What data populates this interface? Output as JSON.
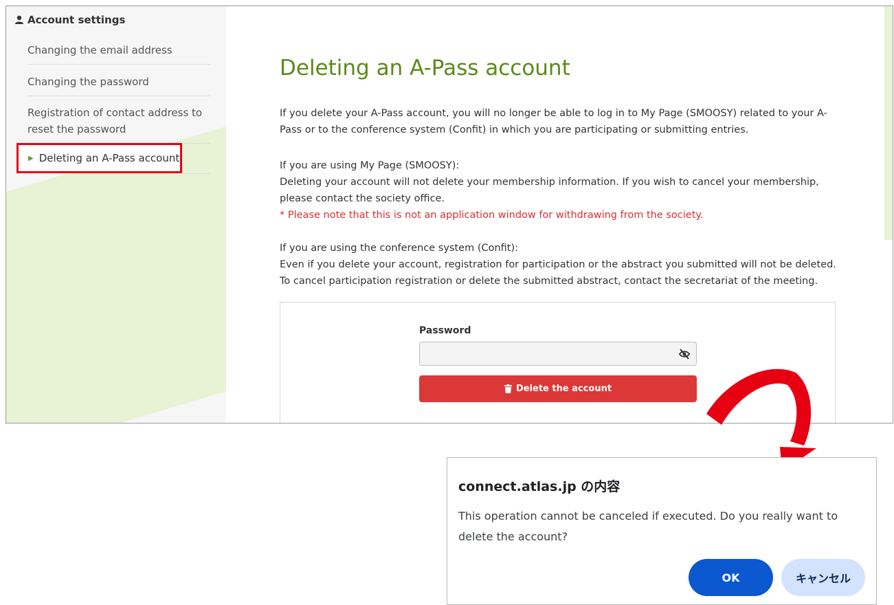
{
  "sidebar": {
    "heading": "Account settings",
    "items": [
      {
        "label": "Changing the email address"
      },
      {
        "label": "Changing the password"
      },
      {
        "label": "Registration of contact address to reset the password"
      },
      {
        "label": "Deleting an A-Pass account"
      }
    ]
  },
  "main": {
    "title": "Deleting an A-Pass account",
    "intro": "If you delete your A-Pass account, you will no longer be able to log in to My Page (SMOOSY) related to your A-Pass or to the conference system (Confit) in which you are participating or submitting entries.",
    "smoosy_heading": "If you are using My Page (SMOOSY):",
    "smoosy_text": "Deleting your account will not delete your membership information. If you wish to cancel your membership, please contact the society office.",
    "smoosy_warning": "* Please note that this is not an application window for withdrawing from the society.",
    "confit_heading": "If you are using the conference system (Confit):",
    "confit_text1": "Even if you delete your account, registration for participation or the abstract you submitted will not be deleted.",
    "confit_text2": "To cancel participation registration or delete the submitted abstract, contact the secretariat of the meeting.",
    "form": {
      "password_label": "Password",
      "password_value": "",
      "delete_label": "Delete the account"
    }
  },
  "dialog": {
    "title": "connect.atlas.jp の内容",
    "message": "This operation cannot be canceled if executed. Do you really want to delete the account?",
    "ok_label": "OK",
    "cancel_label": "キャンセル"
  },
  "colors": {
    "title_green": "#5b8a1a",
    "warning_red": "#d63030",
    "delete_button": "#dc3838",
    "highlight_border": "#e60012",
    "ok_button": "#0b57d0",
    "cancel_button": "#d3e3fd"
  },
  "icons": {
    "heading": "person-icon",
    "active_marker": "triangle-right-icon",
    "password_toggle": "eye-slash-icon",
    "delete": "trash-icon",
    "annotation": "curved-arrow-icon"
  }
}
